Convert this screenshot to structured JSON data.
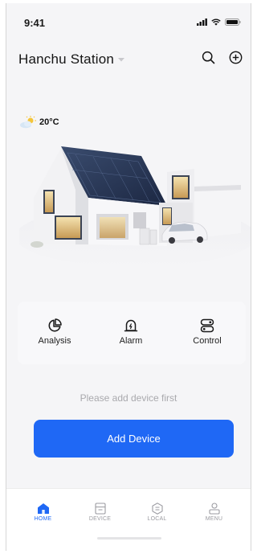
{
  "status_bar": {
    "time": "9:41"
  },
  "header": {
    "station_name": "Hanchu Station"
  },
  "weather": {
    "temperature": "20°C",
    "icon": "partly-cloudy-icon"
  },
  "quick_actions": [
    {
      "label": "Analysis",
      "icon": "pie-chart-icon"
    },
    {
      "label": "Alarm",
      "icon": "alarm-icon"
    },
    {
      "label": "Control",
      "icon": "toggle-icon"
    }
  ],
  "empty_message": "Please add device first",
  "add_device_label": "Add Device",
  "tabs": [
    {
      "label": "HOME",
      "icon": "home-icon",
      "active": true
    },
    {
      "label": "DEVICE",
      "icon": "device-icon",
      "active": false
    },
    {
      "label": "LOCAL",
      "icon": "local-icon",
      "active": false
    },
    {
      "label": "MENU",
      "icon": "menu-icon",
      "active": false
    }
  ],
  "colors": {
    "accent": "#1f68f5",
    "background": "#f5f5f7"
  }
}
